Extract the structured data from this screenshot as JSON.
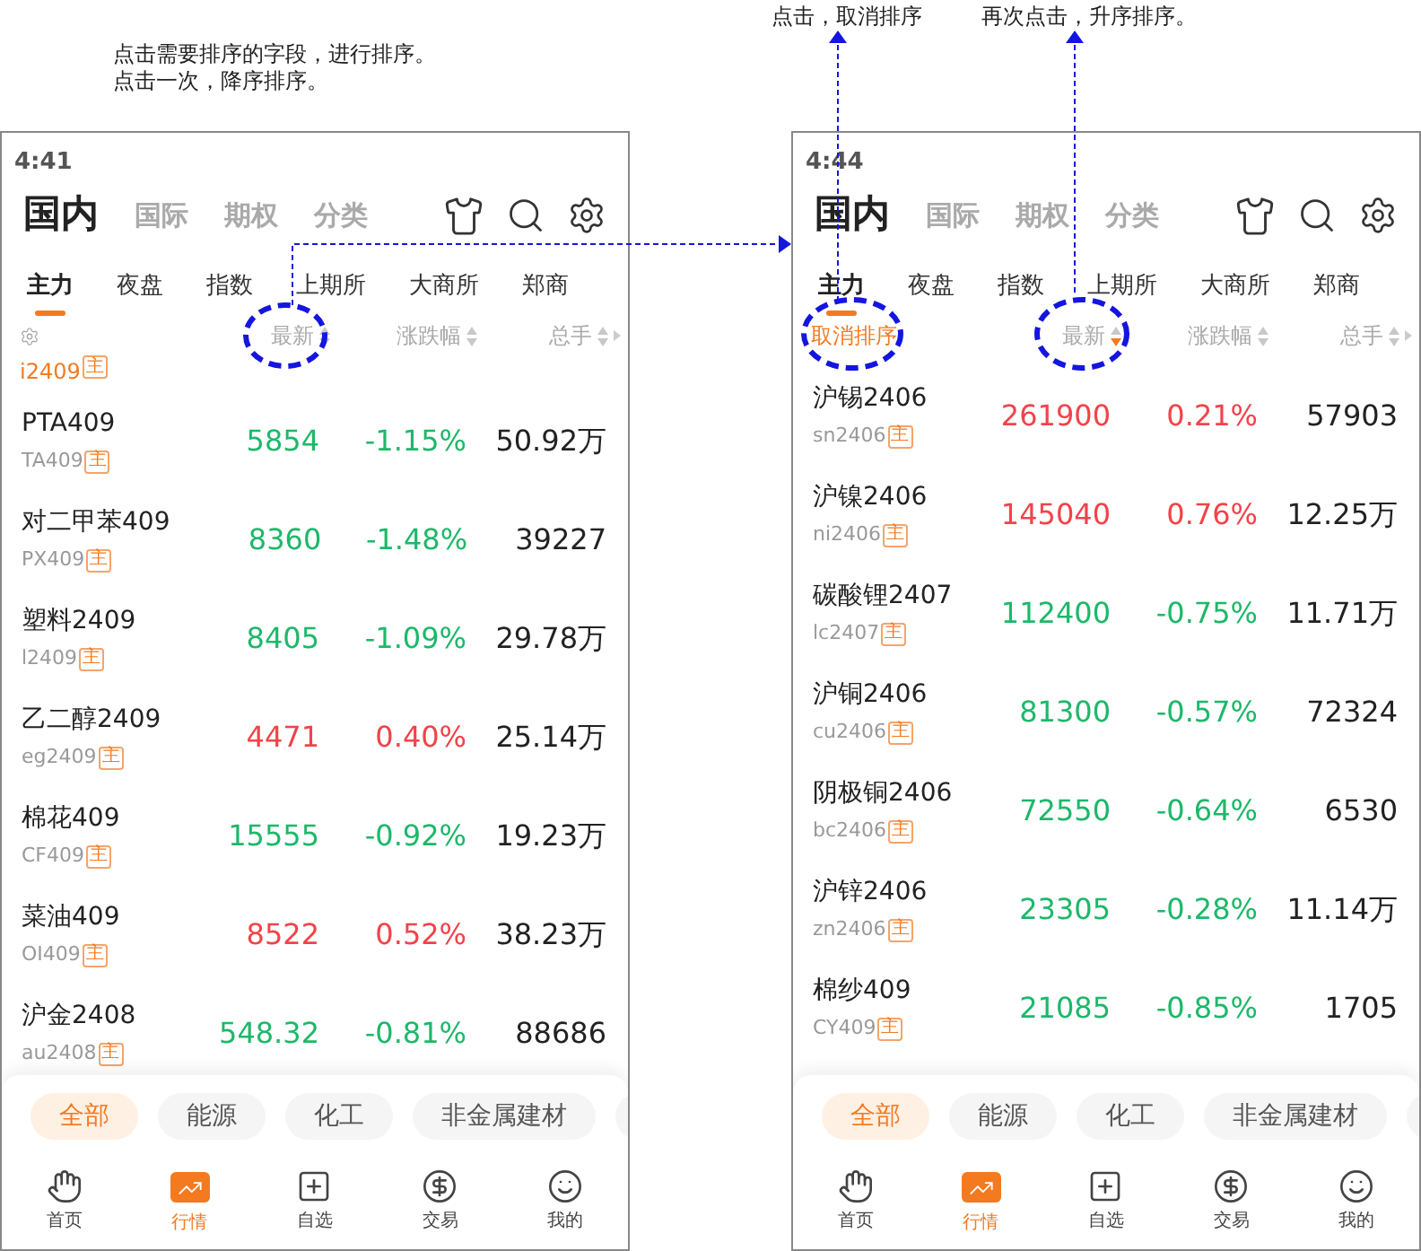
{
  "annotations": {
    "left": [
      "点击需要排序的字段，进行排序。",
      "点击一次，降序排序。"
    ],
    "right": [
      "点击，取消排序",
      "再次点击，升序排序。"
    ]
  },
  "phones": [
    {
      "time": "4:41",
      "top_tabs": [
        {
          "label": "国内",
          "selected": true
        },
        {
          "label": "国际",
          "selected": false
        },
        {
          "label": "期权",
          "selected": false
        },
        {
          "label": "分类",
          "selected": false
        }
      ],
      "sub_tabs": [
        {
          "label": "主力",
          "selected": true
        },
        {
          "label": "夜盘",
          "selected": false
        },
        {
          "label": "指数",
          "selected": false
        },
        {
          "label": "上期所",
          "selected": false
        },
        {
          "label": "大商所",
          "selected": false
        },
        {
          "label": "郑商",
          "selected": false
        }
      ],
      "header": {
        "columns": [
          {
            "label": "最新",
            "descending": false
          },
          {
            "label": "涨跌幅",
            "descending": false
          },
          {
            "label": "总手",
            "descending": false
          }
        ]
      },
      "partial_row": {
        "code": "i2409",
        "badge": "主"
      },
      "rows": [
        {
          "name": "PTA409",
          "code": "TA409",
          "badge": "主",
          "last": "5854",
          "change": "-1.15%",
          "volume": "50.92万",
          "color": "#1db86a"
        },
        {
          "name": "对二甲苯409",
          "code": "PX409",
          "badge": "主",
          "last": "8360",
          "change": "-1.48%",
          "volume": "39227",
          "color": "#1db86a"
        },
        {
          "name": "塑料2409",
          "code": "l2409",
          "badge": "主",
          "last": "8405",
          "change": "-1.09%",
          "volume": "29.78万",
          "color": "#1db86a"
        },
        {
          "name": "乙二醇2409",
          "code": "eg2409",
          "badge": "主",
          "last": "4471",
          "change": "0.40%",
          "volume": "25.14万",
          "color": "#f2434a"
        },
        {
          "name": "棉花409",
          "code": "CF409",
          "badge": "主",
          "last": "15555",
          "change": "-0.92%",
          "volume": "19.23万",
          "color": "#1db86a"
        },
        {
          "name": "菜油409",
          "code": "OI409",
          "badge": "主",
          "last": "8522",
          "change": "0.52%",
          "volume": "38.23万",
          "color": "#f2434a"
        },
        {
          "name": "沪金2408",
          "code": "au2408",
          "badge": "主",
          "last": "548.32",
          "change": "-0.81%",
          "volume": "88686",
          "color": "#1db86a"
        }
      ],
      "categories": [
        {
          "label": "全部",
          "selected": true
        },
        {
          "label": "能源",
          "selected": false
        },
        {
          "label": "化工",
          "selected": false
        },
        {
          "label": "非金属建材",
          "selected": false
        }
      ],
      "nav": [
        {
          "label": "首页",
          "selected": false
        },
        {
          "label": "行情",
          "selected": true
        },
        {
          "label": "自选",
          "selected": false
        },
        {
          "label": "交易",
          "selected": false
        },
        {
          "label": "我的",
          "selected": false
        }
      ]
    },
    {
      "time": "4:44",
      "top_tabs": [
        {
          "label": "国内",
          "selected": true
        },
        {
          "label": "国际",
          "selected": false
        },
        {
          "label": "期权",
          "selected": false
        },
        {
          "label": "分类",
          "selected": false
        }
      ],
      "sub_tabs": [
        {
          "label": "主力",
          "selected": true
        },
        {
          "label": "夜盘",
          "selected": false
        },
        {
          "label": "指数",
          "selected": false
        },
        {
          "label": "上期所",
          "selected": false
        },
        {
          "label": "大商所",
          "selected": false
        },
        {
          "label": "郑商",
          "selected": false
        }
      ],
      "header": {
        "reset": "取消排序",
        "columns": [
          {
            "label": "最新",
            "descending": true
          },
          {
            "label": "涨跌幅",
            "descending": false
          },
          {
            "label": "总手",
            "descending": false
          }
        ]
      },
      "rows": [
        {
          "name": "沪锡2406",
          "code": "sn2406",
          "badge": "主",
          "last": "261900",
          "change": "0.21%",
          "volume": "57903",
          "color": "#f2434a"
        },
        {
          "name": "沪镍2406",
          "code": "ni2406",
          "badge": "主",
          "last": "145040",
          "change": "0.76%",
          "volume": "12.25万",
          "color": "#f2434a"
        },
        {
          "name": "碳酸锂2407",
          "code": "lc2407",
          "badge": "主",
          "last": "112400",
          "change": "-0.75%",
          "volume": "11.71万",
          "color": "#1db86a"
        },
        {
          "name": "沪铜2406",
          "code": "cu2406",
          "badge": "主",
          "last": "81300",
          "change": "-0.57%",
          "volume": "72324",
          "color": "#1db86a"
        },
        {
          "name": "阴极铜2406",
          "code": "bc2406",
          "badge": "主",
          "last": "72550",
          "change": "-0.64%",
          "volume": "6530",
          "color": "#1db86a"
        },
        {
          "name": "沪锌2406",
          "code": "zn2406",
          "badge": "主",
          "last": "23305",
          "change": "-0.28%",
          "volume": "11.14万",
          "color": "#1db86a"
        },
        {
          "name": "棉纱409",
          "code": "CY409",
          "badge": "主",
          "last": "21085",
          "change": "-0.85%",
          "volume": "1705",
          "color": "#1db86a"
        }
      ],
      "categories": [
        {
          "label": "全部",
          "selected": true
        },
        {
          "label": "能源",
          "selected": false
        },
        {
          "label": "化工",
          "selected": false
        },
        {
          "label": "非金属建材",
          "selected": false
        }
      ],
      "nav": [
        {
          "label": "首页",
          "selected": false
        },
        {
          "label": "行情",
          "selected": true
        },
        {
          "label": "自选",
          "selected": false
        },
        {
          "label": "交易",
          "selected": false
        },
        {
          "label": "我的",
          "selected": false
        }
      ]
    }
  ]
}
